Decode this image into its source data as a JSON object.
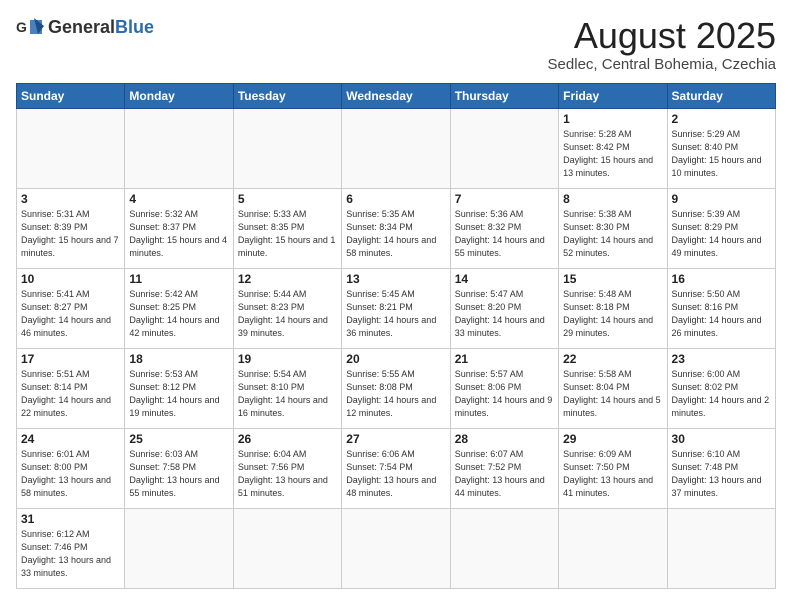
{
  "header": {
    "logo_general": "General",
    "logo_blue": "Blue",
    "month_title": "August 2025",
    "location": "Sedlec, Central Bohemia, Czechia"
  },
  "weekdays": [
    "Sunday",
    "Monday",
    "Tuesday",
    "Wednesday",
    "Thursday",
    "Friday",
    "Saturday"
  ],
  "weeks": [
    [
      {
        "day": "",
        "info": ""
      },
      {
        "day": "",
        "info": ""
      },
      {
        "day": "",
        "info": ""
      },
      {
        "day": "",
        "info": ""
      },
      {
        "day": "",
        "info": ""
      },
      {
        "day": "1",
        "info": "Sunrise: 5:28 AM\nSunset: 8:42 PM\nDaylight: 15 hours and 13 minutes."
      },
      {
        "day": "2",
        "info": "Sunrise: 5:29 AM\nSunset: 8:40 PM\nDaylight: 15 hours and 10 minutes."
      }
    ],
    [
      {
        "day": "3",
        "info": "Sunrise: 5:31 AM\nSunset: 8:39 PM\nDaylight: 15 hours and 7 minutes."
      },
      {
        "day": "4",
        "info": "Sunrise: 5:32 AM\nSunset: 8:37 PM\nDaylight: 15 hours and 4 minutes."
      },
      {
        "day": "5",
        "info": "Sunrise: 5:33 AM\nSunset: 8:35 PM\nDaylight: 15 hours and 1 minute."
      },
      {
        "day": "6",
        "info": "Sunrise: 5:35 AM\nSunset: 8:34 PM\nDaylight: 14 hours and 58 minutes."
      },
      {
        "day": "7",
        "info": "Sunrise: 5:36 AM\nSunset: 8:32 PM\nDaylight: 14 hours and 55 minutes."
      },
      {
        "day": "8",
        "info": "Sunrise: 5:38 AM\nSunset: 8:30 PM\nDaylight: 14 hours and 52 minutes."
      },
      {
        "day": "9",
        "info": "Sunrise: 5:39 AM\nSunset: 8:29 PM\nDaylight: 14 hours and 49 minutes."
      }
    ],
    [
      {
        "day": "10",
        "info": "Sunrise: 5:41 AM\nSunset: 8:27 PM\nDaylight: 14 hours and 46 minutes."
      },
      {
        "day": "11",
        "info": "Sunrise: 5:42 AM\nSunset: 8:25 PM\nDaylight: 14 hours and 42 minutes."
      },
      {
        "day": "12",
        "info": "Sunrise: 5:44 AM\nSunset: 8:23 PM\nDaylight: 14 hours and 39 minutes."
      },
      {
        "day": "13",
        "info": "Sunrise: 5:45 AM\nSunset: 8:21 PM\nDaylight: 14 hours and 36 minutes."
      },
      {
        "day": "14",
        "info": "Sunrise: 5:47 AM\nSunset: 8:20 PM\nDaylight: 14 hours and 33 minutes."
      },
      {
        "day": "15",
        "info": "Sunrise: 5:48 AM\nSunset: 8:18 PM\nDaylight: 14 hours and 29 minutes."
      },
      {
        "day": "16",
        "info": "Sunrise: 5:50 AM\nSunset: 8:16 PM\nDaylight: 14 hours and 26 minutes."
      }
    ],
    [
      {
        "day": "17",
        "info": "Sunrise: 5:51 AM\nSunset: 8:14 PM\nDaylight: 14 hours and 22 minutes."
      },
      {
        "day": "18",
        "info": "Sunrise: 5:53 AM\nSunset: 8:12 PM\nDaylight: 14 hours and 19 minutes."
      },
      {
        "day": "19",
        "info": "Sunrise: 5:54 AM\nSunset: 8:10 PM\nDaylight: 14 hours and 16 minutes."
      },
      {
        "day": "20",
        "info": "Sunrise: 5:55 AM\nSunset: 8:08 PM\nDaylight: 14 hours and 12 minutes."
      },
      {
        "day": "21",
        "info": "Sunrise: 5:57 AM\nSunset: 8:06 PM\nDaylight: 14 hours and 9 minutes."
      },
      {
        "day": "22",
        "info": "Sunrise: 5:58 AM\nSunset: 8:04 PM\nDaylight: 14 hours and 5 minutes."
      },
      {
        "day": "23",
        "info": "Sunrise: 6:00 AM\nSunset: 8:02 PM\nDaylight: 14 hours and 2 minutes."
      }
    ],
    [
      {
        "day": "24",
        "info": "Sunrise: 6:01 AM\nSunset: 8:00 PM\nDaylight: 13 hours and 58 minutes."
      },
      {
        "day": "25",
        "info": "Sunrise: 6:03 AM\nSunset: 7:58 PM\nDaylight: 13 hours and 55 minutes."
      },
      {
        "day": "26",
        "info": "Sunrise: 6:04 AM\nSunset: 7:56 PM\nDaylight: 13 hours and 51 minutes."
      },
      {
        "day": "27",
        "info": "Sunrise: 6:06 AM\nSunset: 7:54 PM\nDaylight: 13 hours and 48 minutes."
      },
      {
        "day": "28",
        "info": "Sunrise: 6:07 AM\nSunset: 7:52 PM\nDaylight: 13 hours and 44 minutes."
      },
      {
        "day": "29",
        "info": "Sunrise: 6:09 AM\nSunset: 7:50 PM\nDaylight: 13 hours and 41 minutes."
      },
      {
        "day": "30",
        "info": "Sunrise: 6:10 AM\nSunset: 7:48 PM\nDaylight: 13 hours and 37 minutes."
      }
    ],
    [
      {
        "day": "31",
        "info": "Sunrise: 6:12 AM\nSunset: 7:46 PM\nDaylight: 13 hours and 33 minutes."
      },
      {
        "day": "",
        "info": ""
      },
      {
        "day": "",
        "info": ""
      },
      {
        "day": "",
        "info": ""
      },
      {
        "day": "",
        "info": ""
      },
      {
        "day": "",
        "info": ""
      },
      {
        "day": "",
        "info": ""
      }
    ]
  ]
}
